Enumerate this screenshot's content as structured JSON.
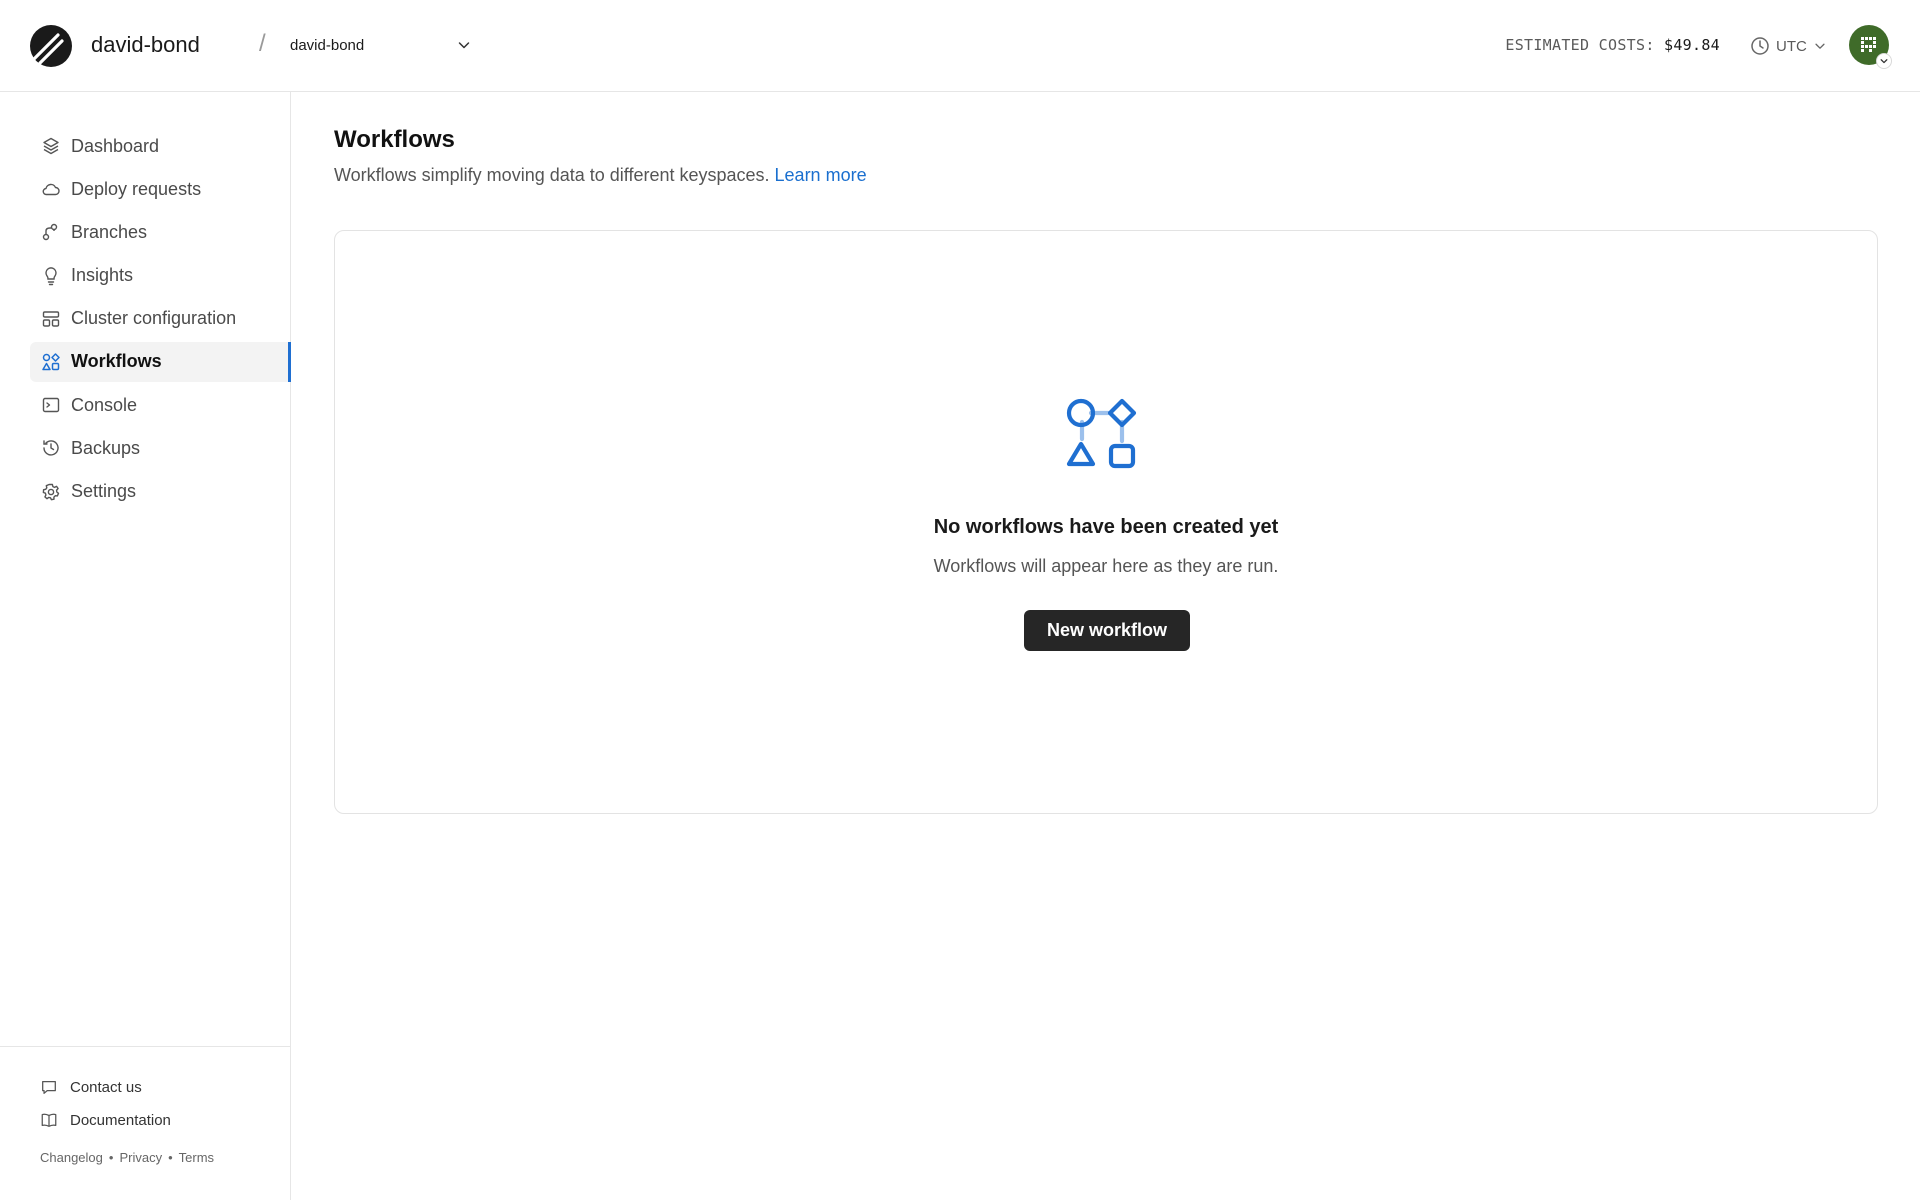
{
  "header": {
    "org_name": "david-bond",
    "separator": "/",
    "database": "david-bond",
    "estimated_costs_label": "ESTIMATED COSTS:",
    "estimated_costs_value": "$49.84",
    "timezone": "UTC"
  },
  "sidebar": {
    "items": [
      {
        "label": "Dashboard",
        "icon": "layers-icon"
      },
      {
        "label": "Deploy requests",
        "icon": "cloud-icon"
      },
      {
        "label": "Branches",
        "icon": "branch-icon"
      },
      {
        "label": "Insights",
        "icon": "lightbulb-icon"
      },
      {
        "label": "Cluster configuration",
        "icon": "cluster-icon"
      },
      {
        "label": "Workflows",
        "icon": "workflow-icon",
        "active": true
      },
      {
        "label": "Console",
        "icon": "terminal-icon"
      },
      {
        "label": "Backups",
        "icon": "history-icon"
      },
      {
        "label": "Settings",
        "icon": "gear-icon"
      }
    ],
    "footer": {
      "contact": "Contact us",
      "docs": "Documentation",
      "changelog": "Changelog",
      "privacy": "Privacy",
      "terms": "Terms",
      "dot": "•"
    }
  },
  "main": {
    "title": "Workflows",
    "description": "Workflows simplify moving data to different keyspaces.",
    "learn_more": "Learn more",
    "empty": {
      "title": "No workflows have been created yet",
      "subtitle": "Workflows will appear here as they are run.",
      "button": "New workflow"
    }
  },
  "colors": {
    "accent": "#1f6fd1",
    "link": "#1a6fcf",
    "button_bg": "#262626",
    "avatar_bg": "#3f6b29"
  }
}
